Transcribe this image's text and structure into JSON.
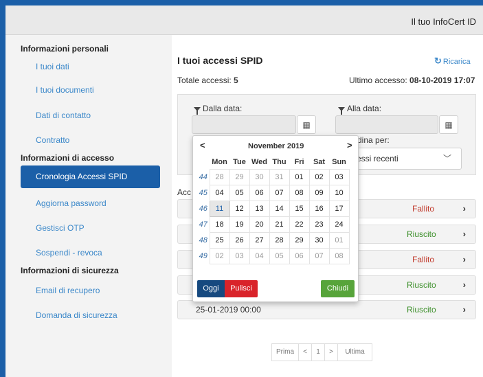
{
  "header": {
    "brand": "Il tuo InfoCert ID"
  },
  "sidebar": {
    "sections": [
      {
        "title": "Informazioni personali"
      },
      {
        "title": "Informazioni di accesso"
      },
      {
        "title": "Informazioni di sicurezza"
      }
    ],
    "items": [
      {
        "label": "I tuoi dati"
      },
      {
        "label": "I tuoi documenti"
      },
      {
        "label": "Dati di contatto"
      },
      {
        "label": "Contratto"
      },
      {
        "label": "Cronologia Accessi SPID"
      },
      {
        "label": "Aggiorna password"
      },
      {
        "label": "Gestisci OTP"
      },
      {
        "label": "Sospendi - revoca"
      },
      {
        "label": "Email di recupero"
      },
      {
        "label": "Domanda di sicurezza"
      }
    ]
  },
  "main": {
    "title": "I tuoi accessi SPID",
    "reload_label": "Ricarica",
    "totale_label": "Totale accessi:",
    "totale_value": "5",
    "ultimo_label": "Ultimo accesso:",
    "ultimo_value": "08-10-2019 17:07",
    "filter": {
      "dalla_label": "Dalla data:",
      "alla_label": "Alla data:",
      "ordina_label": "dina per:",
      "ordina_value": "essi recenti"
    },
    "accessi_label": "Acc",
    "rows": [
      {
        "date": "",
        "status": "Fallito"
      },
      {
        "date": "",
        "status": "Riuscito"
      },
      {
        "date": "",
        "status": "Fallito"
      },
      {
        "date": "",
        "status": "Riuscito"
      },
      {
        "date": "25-01-2019 00:00",
        "status": "Riuscito"
      }
    ],
    "pager": {
      "first": "Prima",
      "prev": "<",
      "page": "1",
      "next": ">",
      "last": "Ultima"
    }
  },
  "datepicker": {
    "prev": "<",
    "next": ">",
    "title": "November 2019",
    "weekdays": [
      "Mon",
      "Tue",
      "Wed",
      "Thu",
      "Fri",
      "Sat",
      "Sun"
    ],
    "weeks": [
      {
        "wk": "44",
        "days": [
          "28",
          "29",
          "30",
          "31",
          "01",
          "02",
          "03"
        ]
      },
      {
        "wk": "45",
        "days": [
          "04",
          "05",
          "06",
          "07",
          "08",
          "09",
          "10"
        ]
      },
      {
        "wk": "46",
        "days": [
          "11",
          "12",
          "13",
          "14",
          "15",
          "16",
          "17"
        ]
      },
      {
        "wk": "47",
        "days": [
          "18",
          "19",
          "20",
          "21",
          "22",
          "23",
          "24"
        ]
      },
      {
        "wk": "48",
        "days": [
          "25",
          "26",
          "27",
          "28",
          "29",
          "30",
          "01"
        ]
      },
      {
        "wk": "49",
        "days": [
          "02",
          "03",
          "04",
          "05",
          "06",
          "07",
          "08"
        ]
      }
    ],
    "today": "Oggi",
    "clear": "Pulisci",
    "close": "Chiudi"
  },
  "colors": {
    "primary": "#1b5fa8",
    "link": "#3a87c9",
    "success": "#57a43a",
    "danger": "#d9232a",
    "fail_text": "#c0392b",
    "ok_text": "#3c8f2a"
  }
}
